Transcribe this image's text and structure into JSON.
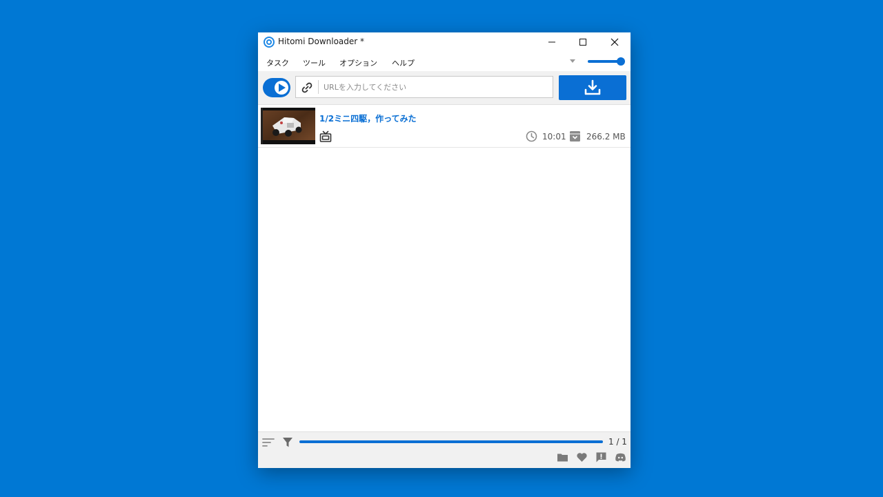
{
  "window": {
    "title": "Hitomi Downloader *"
  },
  "menu": {
    "items": [
      "タスク",
      "ツール",
      "オプション",
      "ヘルプ"
    ]
  },
  "toolbar": {
    "url_placeholder": "URLを入力してください",
    "url_value": "",
    "volume_level": 0.85
  },
  "tasks": [
    {
      "title": "1/2ミニ四駆，作ってみた",
      "duration": "10:01",
      "size": "266.2 MB",
      "type_icon": "tv-icon"
    }
  ],
  "footer": {
    "progress": 1.0,
    "page_count": "1 / 1",
    "icons": [
      "folder-icon",
      "heart-icon",
      "feedback-icon",
      "discord-icon"
    ]
  },
  "colors": {
    "desktop": "#0078d4",
    "accent": "#0a6fd4"
  }
}
